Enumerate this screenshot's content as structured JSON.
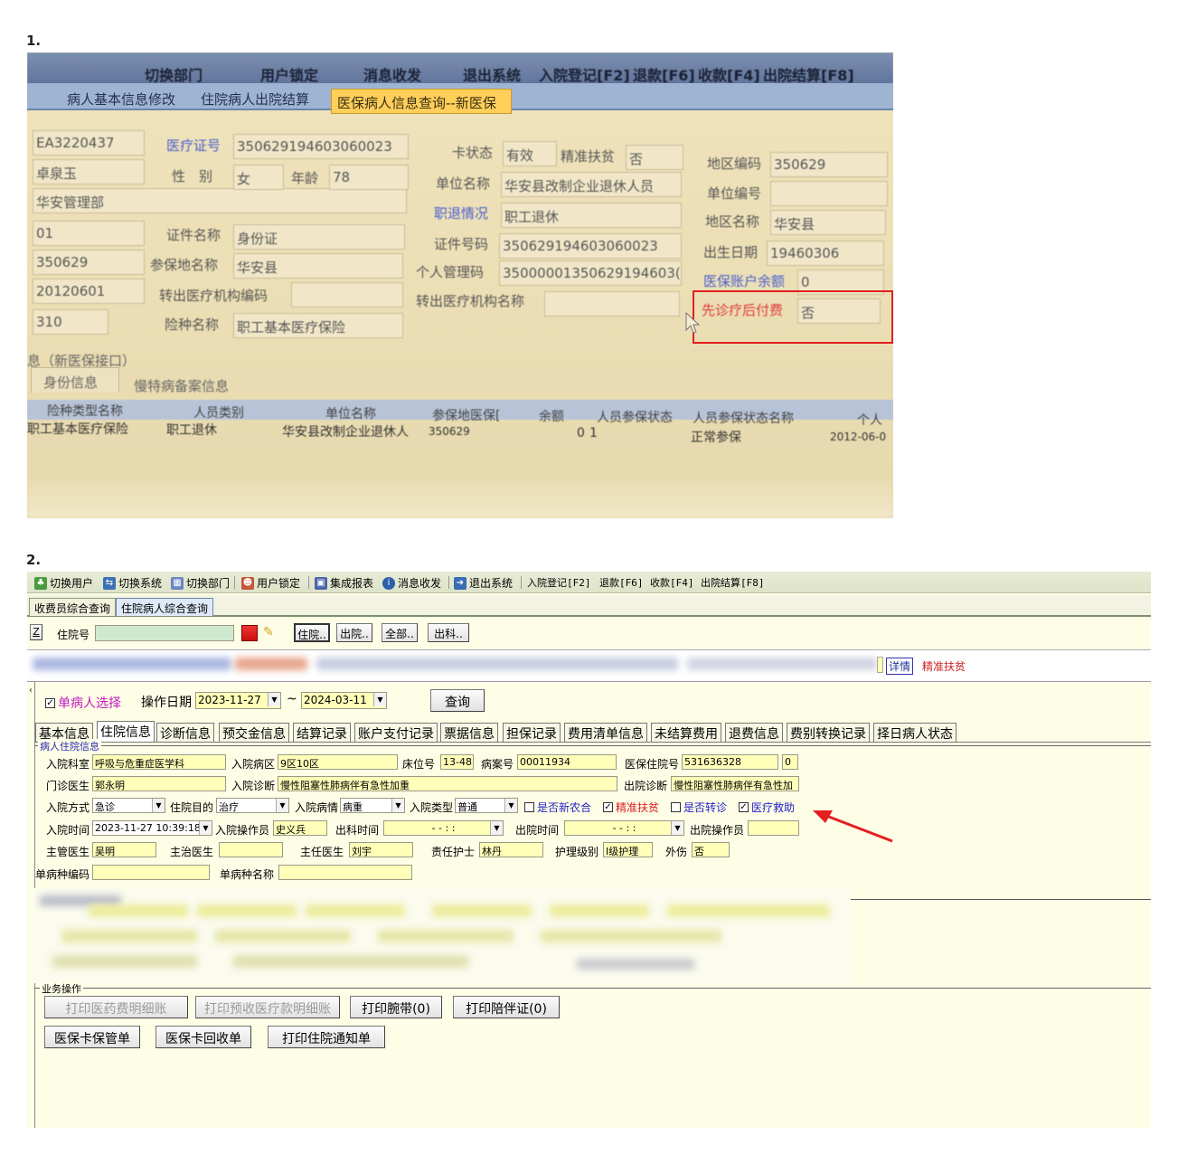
{
  "section_numbers": [
    "1.",
    "2."
  ],
  "photo": {
    "toolbar": [
      "切换部门",
      "用户锁定",
      "消息收发",
      "退出系统",
      "入院登记[F2]",
      "退款[F6]",
      "收款[F4]",
      "出院结算[F8]"
    ],
    "tabs": [
      "病人基本信息修改",
      "住院病人出院结算"
    ],
    "active_tab": "医保病人信息查询--新医保",
    "left_values": [
      "EA3220437",
      "卓泉玉",
      "华安管理部",
      "01",
      "350629",
      "20120601",
      "310"
    ],
    "fields": {
      "card_no_label": "医疗证号",
      "card_no": "350629194603060023",
      "gender_label": "性　别",
      "gender": "女",
      "age_label": "年龄",
      "age": "78",
      "id_type_label": "证件名称",
      "id_type": "身份证",
      "insured_place_label": "参保地名称",
      "insured_place": "华安县",
      "transfer_org_code_label": "转出医疗机构编码",
      "transfer_org_code": "",
      "insurance_type_label": "险种名称",
      "insurance_type": "职工基本医疗保险",
      "card_status_label": "卡状态",
      "card_status": "有效",
      "poverty_label": "精准扶贫",
      "poverty": "否",
      "unit_name_label": "单位名称",
      "unit_name": "华安县改制企业退休人员",
      "retire_label": "职退情况",
      "retire": "职工退休",
      "id_no_label": "证件号码",
      "id_no": "350629194603060023",
      "personal_code_label": "个人管理码",
      "personal_code": "35000001350629194603(",
      "transfer_org_name_label": "转出医疗机构名称",
      "transfer_org_name": "",
      "region_code_label": "地区编码",
      "region_code": "350629",
      "unit_code_label": "单位编号",
      "unit_code": "",
      "region_name_label": "地区名称",
      "region_name": "华安县",
      "birth_label": "出生日期",
      "birth": "19460306",
      "balance_label": "医保账户余额",
      "balance": "0",
      "pay_later_label": "先诊疗后付费",
      "pay_later": "否"
    },
    "group_title": "息（新医保接口）",
    "subtabs": [
      "身份信息",
      "慢特病备案信息"
    ],
    "grid_headers": [
      "险种类型名称",
      "人员类别",
      "单位名称",
      "参保地医保[",
      "余额",
      "人员参保状态",
      "人员参保状态名称",
      "个人"
    ],
    "grid_row": [
      "职工基本医疗保险",
      "职工退休",
      "华安县改制企业退休人",
      "350629",
      "0",
      "1",
      "正常参保",
      "2012-06-0"
    ]
  },
  "shot": {
    "toolbar": [
      {
        "label": "切换用户",
        "icon": "users-icon"
      },
      {
        "label": "切换系统",
        "icon": "switch-system-icon"
      },
      {
        "label": "切换部门",
        "icon": "department-icon"
      },
      {
        "label": "用户锁定",
        "icon": "lock-user-icon"
      },
      {
        "label": "集成报表",
        "icon": "report-icon"
      },
      {
        "label": "消息收发",
        "icon": "message-icon"
      },
      {
        "label": "退出系统",
        "icon": "exit-icon"
      },
      {
        "label": "入院登记[F2]"
      },
      {
        "label": "退款[F6]"
      },
      {
        "label": "收款[F4]"
      },
      {
        "label": "出院结算[F8]"
      }
    ],
    "tabs": [
      "收费员综合查询",
      "住院病人综合查询"
    ],
    "search": {
      "z_label": "Z",
      "zyh_label": "住院号",
      "zyh_value": "",
      "buttons": [
        "住院..",
        "出院..",
        "全部..",
        "出科.."
      ]
    },
    "banner": {
      "detail_label": "详情",
      "poverty_text": "精准扶贫"
    },
    "filter": {
      "single_patient_label": "单病人选择",
      "op_date_label": "操作日期",
      "date_from": "2023-11-27",
      "tilde": "~",
      "date_to": "2024-03-11",
      "query_button": "查询"
    },
    "panel_tabs": [
      "基本信息",
      "住院信息",
      "诊断信息",
      "预交金信息",
      "结算记录",
      "账户支付记录",
      "票据信息",
      "担保记录",
      "费用清单信息",
      "未结算费用",
      "退费信息",
      "费别转换记录",
      "择日病人状态"
    ],
    "inpatient": {
      "group_title": "病人住院信息",
      "dept_label": "入院科室",
      "dept": "呼吸与危重症医学科",
      "ward_label": "入院病区",
      "ward": "9区10区",
      "bed_label": "床位号",
      "bed": "13-48",
      "record_label": "病案号",
      "record": "00011934",
      "ins_no_label": "医保住院号",
      "ins_no": "531636328",
      "ins_no_extra": "0",
      "doctor_label": "门诊医生",
      "doctor": "郭永明",
      "diag_label": "入院诊断",
      "diag": "慢性阻塞性肺病伴有急性加重",
      "out_diag_label": "出院诊断",
      "out_diag": "慢性阻塞性肺病伴有急性加",
      "mode_label": "入院方式",
      "mode": "急诊",
      "purpose_label": "住院目的",
      "purpose": "治疗",
      "condition_label": "入院病情",
      "condition": "病重",
      "type_label": "入院类型",
      "type": "普通",
      "chk_ncms": "是否新农合",
      "chk_poverty": "精准扶贫",
      "chk_transfer": "是否转诊",
      "chk_aid": "医疗救助",
      "in_time_label": "入院时间",
      "in_time": "2023-11-27 10:39:18",
      "in_operator_label": "入院操作员",
      "in_operator": "史义兵",
      "out_dept_time_label": "出科时间",
      "out_dept_time": "- -   : :",
      "out_time_label": "出院时间",
      "out_time": "- -   : :",
      "out_operator_label": "出院操作员",
      "out_operator": "",
      "attending_label": "主管医生",
      "attending": "吴明",
      "treating_label": "主治医生",
      "treating": "",
      "chief_label": "主任医生",
      "chief": "刘宇",
      "nurse_label": "责任护士",
      "nurse": "林丹",
      "care_level_label": "护理级别",
      "care_level": "Ⅰ级护理",
      "injury_label": "外伤",
      "injury": "否",
      "disease_code_label": "单病种编码",
      "disease_code": "",
      "disease_name_label": "单病种名称",
      "disease_name": ""
    },
    "business": {
      "group_title": "业务操作",
      "buttons_row1": [
        "打印医药费明细账",
        "打印预收医疗款明细账",
        "打印腕带(0)",
        "打印陪伴证(0)"
      ],
      "buttons_row2": [
        "医保卡保管单",
        "医保卡回收单",
        "打印住院通知单"
      ]
    },
    "accent_colors": {
      "arrow": "#e51f1f",
      "highlight_box": "#e21f1f",
      "field_bg": "#ffffb9",
      "panel_bg": "#fefde6"
    }
  }
}
